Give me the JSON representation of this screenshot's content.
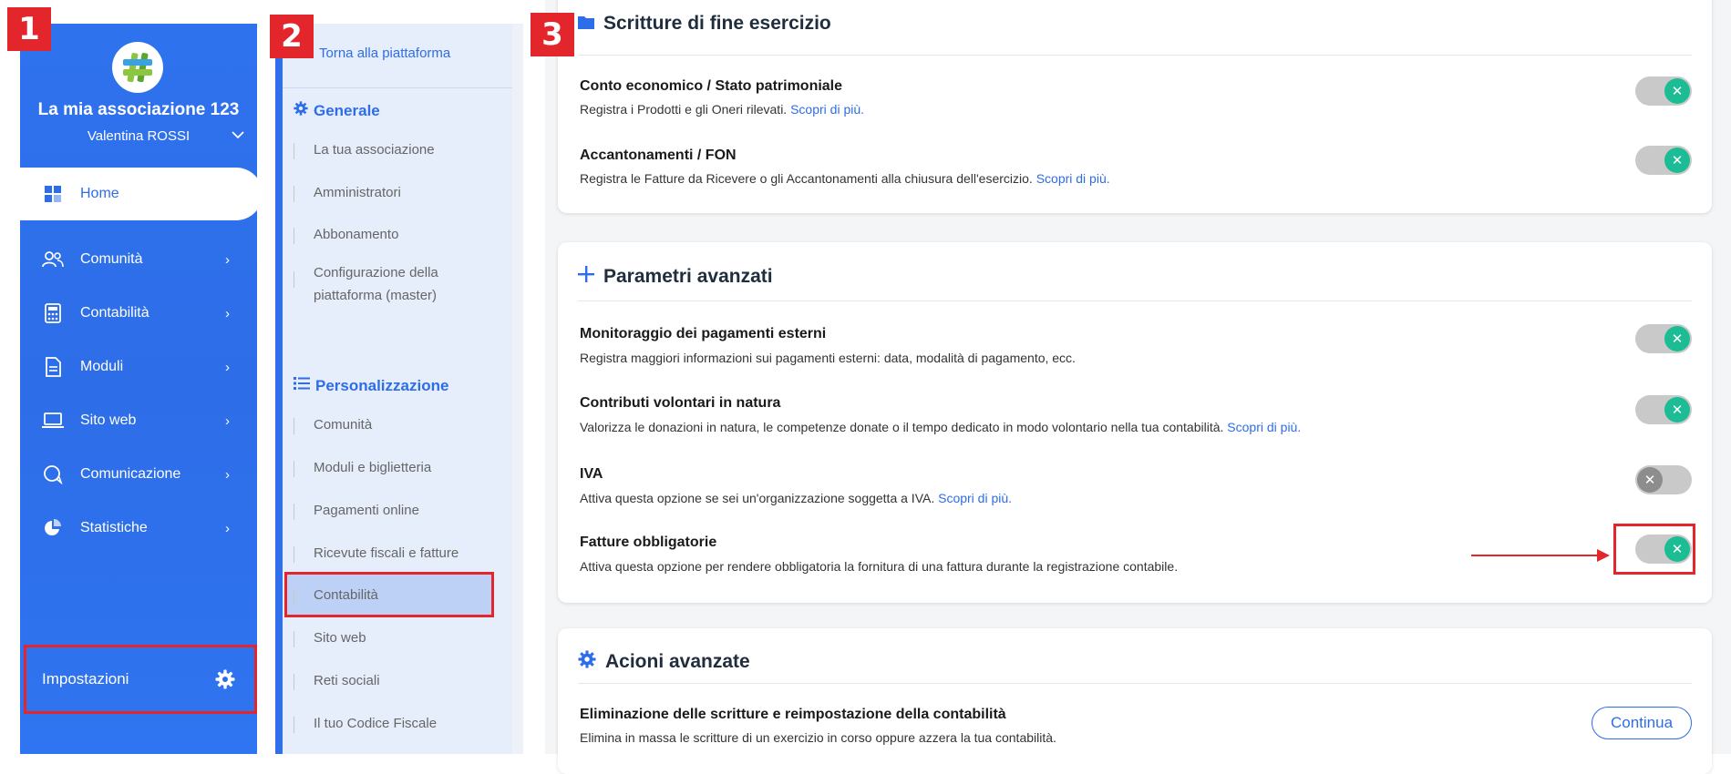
{
  "badges": [
    "1",
    "2",
    "3"
  ],
  "sidebar": {
    "org_name": "La mia associazione 123",
    "user_name": "Valentina ROSSI",
    "items": [
      {
        "label": "Home",
        "icon": "dashboard-icon"
      },
      {
        "label": "Comunità",
        "icon": "users-icon"
      },
      {
        "label": "Contabilità",
        "icon": "calculator-icon"
      },
      {
        "label": "Moduli",
        "icon": "document-icon"
      },
      {
        "label": "Sito web",
        "icon": "laptop-icon"
      },
      {
        "label": "Comunicazione",
        "icon": "chat-icon"
      },
      {
        "label": "Statistiche",
        "icon": "pie-chart-icon"
      }
    ],
    "settings_label": "Impostazioni"
  },
  "submenu": {
    "back_link": "Torna alla piattaforma",
    "general_title": "Generale",
    "general_items": [
      "La tua associazione",
      "Amministratori",
      "Abbonamento",
      "Configurazione della",
      "piattaforma (master)"
    ],
    "custom_title": "Personalizzazione",
    "custom_items": [
      "Comunità",
      "Moduli e biglietteria",
      "Pagamenti online",
      "Ricevute fiscali e fatture",
      "Contabilità",
      "Sito web",
      "Reti sociali",
      "Il tuo Codice Fiscale"
    ]
  },
  "main": {
    "card1": {
      "title": "Scritture di fine esercizio",
      "rows": [
        {
          "title": "Conto economico / Stato patrimoniale",
          "desc": "Registra i Prodotti e gli Oneri rilevati.",
          "link": "Scopri di più.",
          "on": true
        },
        {
          "title": "Accantonamenti / FON",
          "desc": "Registra le Fatture da Ricevere o gli Accantonamenti alla chiusura dell'esercizio.",
          "link": "Scopri di più.",
          "on": true
        }
      ]
    },
    "card2": {
      "title": "Parametri avanzati",
      "rows": [
        {
          "title": "Monitoraggio dei pagamenti esterni",
          "desc": "Registra maggiori informazioni sui pagamenti esterni: data, modalità di pagamento, ecc.",
          "link": "",
          "on": true
        },
        {
          "title": "Contributi volontari in natura",
          "desc": "Valorizza le donazioni in natura, le competenze donate o il tempo dedicato in modo volontario nella tua contabilità.",
          "link": "Scopri di più.",
          "on": true
        },
        {
          "title": "IVA",
          "desc": "Attiva questa opzione se sei un'organizzazione soggetta a IVA.",
          "link": "Scopri di più.",
          "on": false
        },
        {
          "title": "Fatture obbligatorie",
          "desc": "Attiva questa opzione per rendere obbligatoria la fornitura di una fattura durante la registrazione contabile.",
          "link": "",
          "on": true
        }
      ]
    },
    "card3": {
      "title": "Acioni avanzate",
      "row_title": "Eliminazione delle scritture e reimpostazione della contabilità",
      "row_desc": "Elimina in massa le scritture di un exercizio in corso oppure azzera la tua contabilità.",
      "button": "Continua"
    },
    "toggle_glyph": "✕"
  },
  "colors": {
    "primary": "#2e6de8",
    "toggle_on": "#1cbc94",
    "annotation": "#e3262b"
  }
}
